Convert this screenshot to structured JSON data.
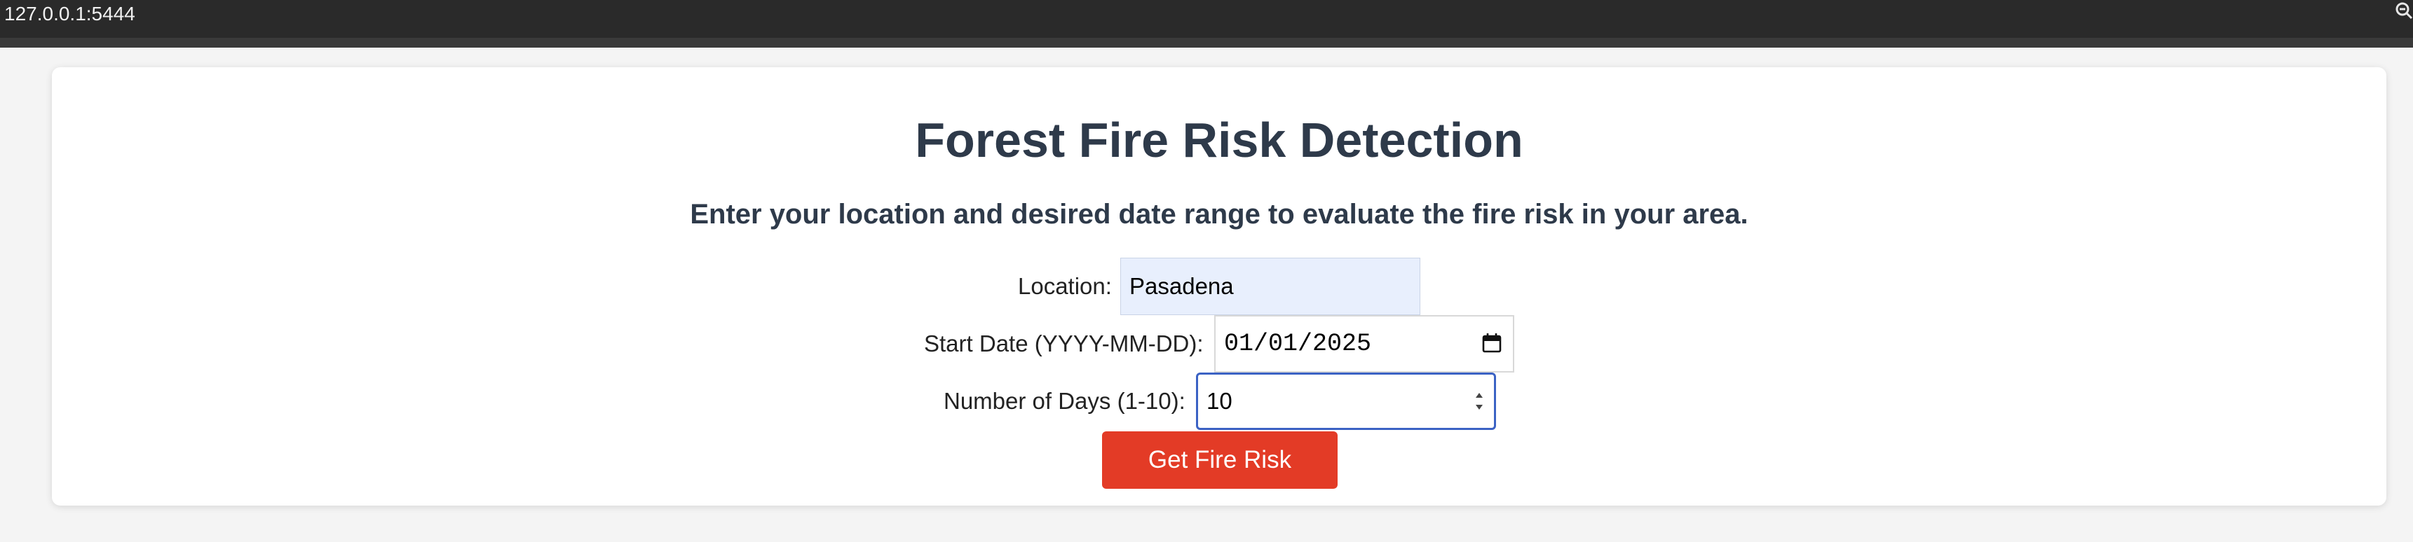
{
  "browser": {
    "url": "127.0.0.1:5444",
    "zoom_icon": "zoom-out-icon"
  },
  "page": {
    "title": "Forest Fire Risk Detection",
    "subtitle": "Enter your location and desired date range to evaluate the fire risk in your area."
  },
  "form": {
    "location": {
      "label": "Location:",
      "value": "Pasadena"
    },
    "start_date": {
      "label": "Start Date (YYYY-MM-DD):",
      "value": "01/01/2025",
      "icon": "calendar-icon"
    },
    "days": {
      "label": "Number of Days (1-10):",
      "value": "10",
      "icon": "spinner-icon"
    },
    "submit_label": "Get Fire Risk"
  },
  "colors": {
    "title": "#2e3a4a",
    "button": "#e33b26",
    "focus_border": "#3b62c4",
    "autofill_bg": "#e8effd"
  }
}
